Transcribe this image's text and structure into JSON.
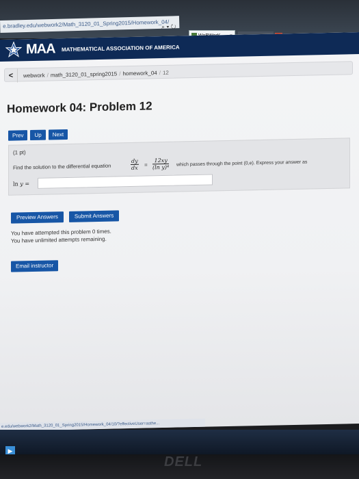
{
  "browser": {
    "address_url": "e.bradley.edu/webwork2/Math_3120_01_Spring2015/Homework_04/",
    "tab_title": "WeBWorK...",
    "tab_close": "×",
    "other_tab_icon": "G",
    "status_url": "e.edu/webwork2/Math_3120_01_Spring2015/Homework_04/10/?effectiveUser=asthe..."
  },
  "header": {
    "logo": "MAA",
    "org_name": "MATHEMATICAL ASSOCIATION OF AMERICA"
  },
  "breadcrumb": {
    "back": "<",
    "items": [
      "webwork",
      "math_3120_01_spring2015",
      "homework_04",
      "12"
    ],
    "sep": "/"
  },
  "page": {
    "title": "Homework 04: Problem 12"
  },
  "nav": {
    "prev": "Prev",
    "up": "Up",
    "next": "Next"
  },
  "problem": {
    "points": "(1 pt)",
    "intro": "Find the solution to the differential equation",
    "lhs_num": "dy",
    "lhs_den": "dx",
    "equals": "=",
    "rhs_num": "12xy",
    "rhs_den": "(ln y)⁴",
    "passes": "which passes through the point (0,e). Express your answer as",
    "answer_label_fn": "ln",
    "answer_label_var": "y",
    "answer_label_eq": "=",
    "answer_value": ""
  },
  "actions": {
    "preview": "Preview Answers",
    "submit": "Submit Answers",
    "attempted": "You have attempted this problem 0 times.",
    "remaining": "You have unlimited attempts remaining.",
    "email": "Email instructor"
  },
  "monitor": {
    "brand": "DELL"
  }
}
